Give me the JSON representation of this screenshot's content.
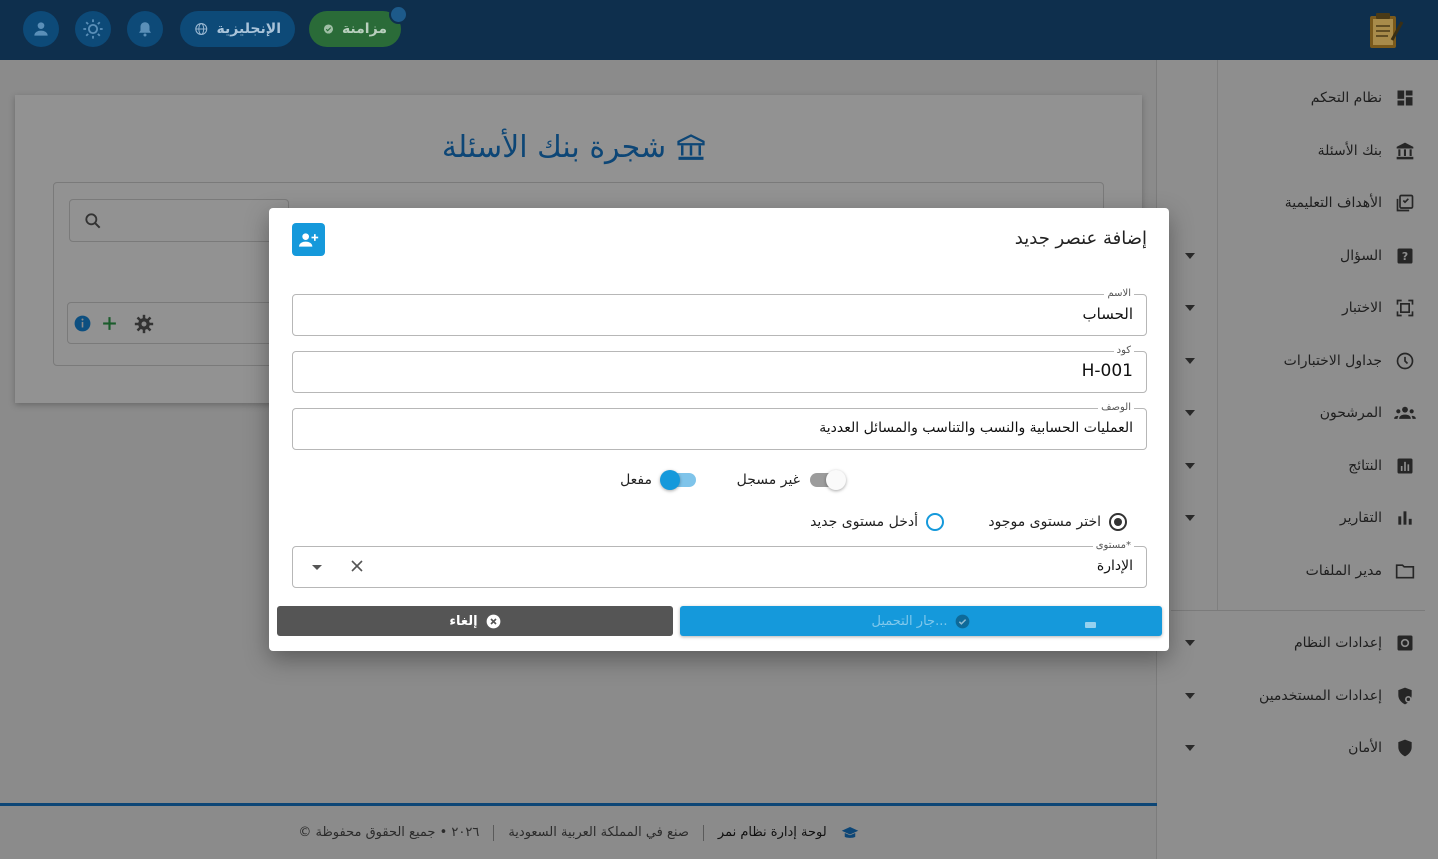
{
  "topbar": {
    "language_label": "الإنجليزية",
    "sync_label": "مزامنة",
    "icons": [
      "user-icon",
      "sun-icon",
      "bell-icon",
      "globe-icon",
      "check-circle-icon",
      "exam-logo-icon"
    ]
  },
  "sidebar": {
    "items": [
      {
        "label": "نظام التحكم",
        "icon": "dashboard-icon"
      },
      {
        "label": "بنك الأسئلة",
        "icon": "bank-icon"
      },
      {
        "label": "الأهداف التعليمية",
        "icon": "goals-icon"
      },
      {
        "label": "السؤال",
        "icon": "question-icon"
      },
      {
        "label": "الاختبار",
        "icon": "exam-icon"
      },
      {
        "label": "جداول الاختبارات",
        "icon": "clock-icon"
      },
      {
        "label": "المرشحون",
        "icon": "people-icon"
      },
      {
        "label": "النتائج",
        "icon": "results-icon"
      },
      {
        "label": "التقارير",
        "icon": "reports-icon"
      },
      {
        "label": "مدير الملفات",
        "icon": "folder-icon"
      },
      {
        "label": "إعدادات النظام",
        "icon": "settings-icon"
      },
      {
        "label": "إعدادات المستخدمين",
        "icon": "user-shield-icon"
      },
      {
        "label": "الأمان",
        "icon": "shield-icon"
      }
    ]
  },
  "main": {
    "title": "شجرة بنك الأسئلة"
  },
  "modal": {
    "title": "إضافة عنصر جديد",
    "name_label": "الاسم",
    "name_value": "الحساب",
    "code_label": "كود",
    "code_value": "H-001",
    "description_label": "الوصف",
    "description_value": "العمليات الحسابية والنسب والتناسب والمسائل العددية",
    "toggle_registered_label": "غير مسجل",
    "toggle_enabled_label": "مفعل",
    "radio_existing_label": "اختر مستوى موجود",
    "radio_new_label": "أدخل مستوى جديد",
    "level_label": "مستوى*",
    "level_value": "الإدارة",
    "cancel_label": "إلغاء",
    "save_label": "جار التحميل..."
  },
  "footer": {
    "brand": "لوحة إدارة نظام نمر",
    "made_in": "صنع في المملكة العربية السعودية",
    "copyright": "© ٢٠٢٦ • جميع الحقوق محفوظة"
  },
  "colors": {
    "topbar": "#0e2f4d",
    "accent": "#1599db",
    "sync_green": "#2a6b38",
    "overlay_bg": "#8b8b8b",
    "cancel_button": "#555555"
  }
}
